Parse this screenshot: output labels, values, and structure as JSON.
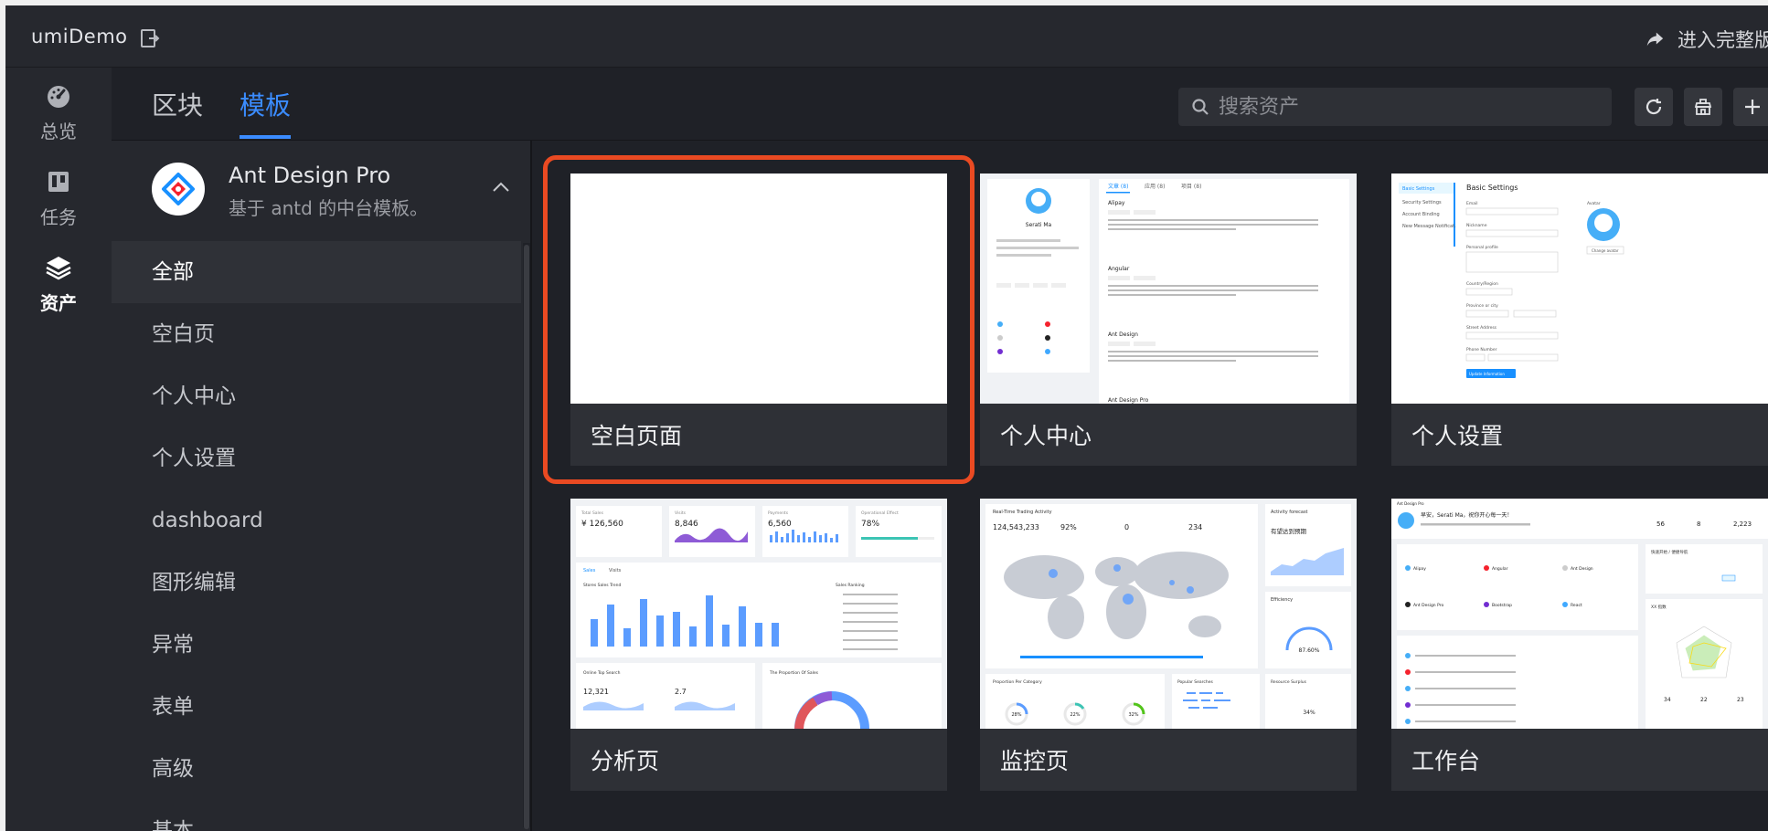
{
  "header": {
    "app_name": "umiDemo",
    "full_version_label": "进入完整版"
  },
  "rail": {
    "items": [
      {
        "label": "总览",
        "icon": "dashboard-icon"
      },
      {
        "label": "任务",
        "icon": "task-board-icon"
      },
      {
        "label": "资产",
        "icon": "layers-icon",
        "active": true
      }
    ]
  },
  "tabs": [
    {
      "label": "区块"
    },
    {
      "label": "模板",
      "active": true
    }
  ],
  "search": {
    "placeholder": "搜索资产"
  },
  "toolbar": {
    "icons": [
      "refresh-icon",
      "store-icon",
      "plus-icon"
    ]
  },
  "pack": {
    "title": "Ant Design Pro",
    "subtitle": "基于 antd 的中台模板。"
  },
  "categories": [
    "全部",
    "空白页",
    "个人中心",
    "个人设置",
    "dashboard",
    "图形编辑",
    "异常",
    "表单",
    "高级",
    "基本"
  ],
  "active_category": "全部",
  "cards": [
    {
      "caption": "空白页面",
      "selected": true
    },
    {
      "caption": "个人中心"
    },
    {
      "caption": "个人设置"
    },
    {
      "caption": "分析页"
    },
    {
      "caption": "监控页"
    },
    {
      "caption": "工作台"
    }
  ],
  "thumbs": {
    "center": {
      "name": "Serati Ma",
      "tabs": [
        "文章 (8)",
        "应用 (8)",
        "项目 (8)"
      ],
      "sections": [
        "Alipay",
        "Angular",
        "Ant Design",
        "Ant Design Pro"
      ]
    },
    "settings": {
      "menu": [
        "Basic Settings",
        "Security Settings",
        "Account Binding",
        "New Message Notificat."
      ],
      "title": "Basic Settings",
      "fields": [
        "Email",
        "Nickname",
        "Personal profile",
        "Country/Region",
        "Province or city",
        "Street Address",
        "Phone Number"
      ],
      "button": "Update Information",
      "avatar_label": "Avatar",
      "change_label": "Change avatar"
    },
    "analysis": {
      "kpis": [
        "Total Sales",
        "Visits",
        "Payments",
        "Operational Effect"
      ],
      "kpi_values": [
        "¥ 126,560",
        "8,846",
        "6,560",
        "78%"
      ],
      "tabs": [
        "Sales",
        "Visits"
      ],
      "chart_title": "Stores Sales Trend",
      "ranking_title": "Sales Ranking",
      "search_title": "Online Top Search",
      "proportion_title": "The Proportion Of Sales",
      "search_values": [
        "12,321",
        "2.7"
      ]
    },
    "monitor": {
      "title": "Real-Time Trading Activity",
      "stats": [
        "124,543,233",
        "92%",
        "0",
        "234"
      ],
      "forecast_title": "Activity forecast",
      "forecast_sub": "有望达到预期",
      "efficiency_title": "Efficiency",
      "efficiency_value": "87.60%",
      "proportion_title": "Proportion Per Category",
      "rings": [
        "28%",
        "22%",
        "32%"
      ],
      "popular_title": "Popular Searches",
      "resource_title": "Resource Surplus",
      "resource_value": "34%"
    },
    "workplace": {
      "brand": "Ant Design Pro",
      "greeting": "早安，Serati Ma，祝你开心每一天！",
      "stats": [
        "56",
        "8",
        "2,223"
      ],
      "projects": [
        "Alipay",
        "Angular",
        "Ant Design",
        "Ant Design Pro",
        "Bootstrap",
        "React"
      ],
      "nav_title": "快速开始 / 便捷导航",
      "radar_title": "XX 指数",
      "radar_values": [
        "34",
        "22",
        "23"
      ]
    }
  },
  "colors": {
    "accent": "#3b8cff",
    "selected_outline": "#ea4a22",
    "chart_blue": "#5b9cff",
    "purple": "#8e5bd6",
    "teal": "#3cc4b4"
  }
}
